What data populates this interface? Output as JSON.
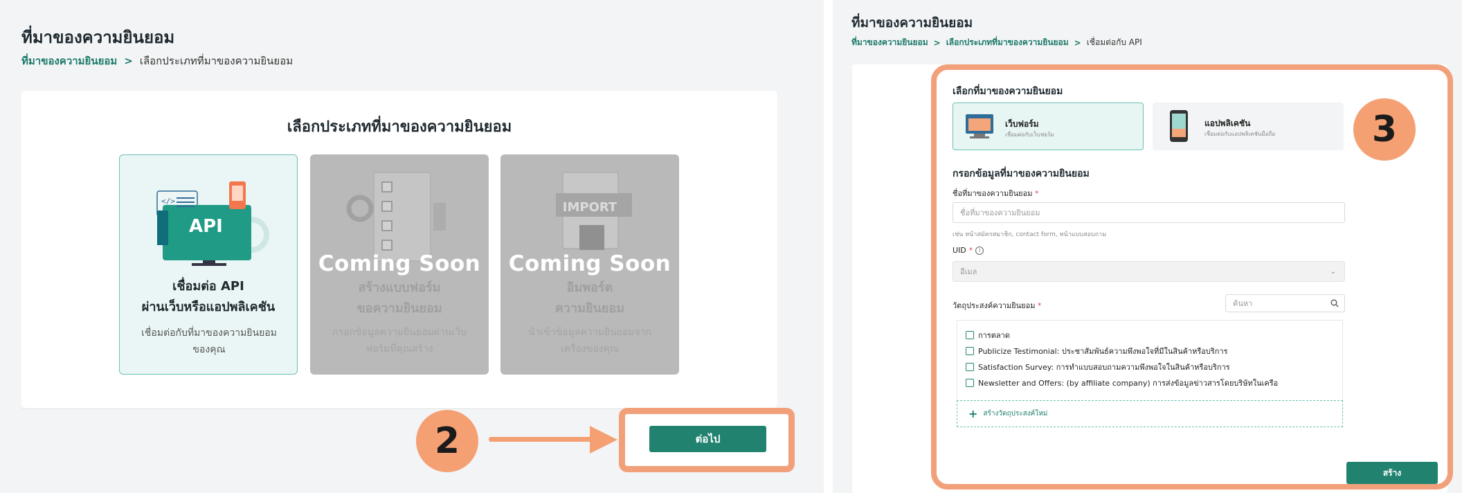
{
  "left": {
    "page_title": "ที่มาของความยินยอม",
    "breadcrumb": {
      "root": "ที่มาของความยินยอม",
      "separator": ">",
      "current": "เลือกประเภทที่มาของความยินยอม"
    },
    "card_title": "เลือกประเภทที่มาของความยินยอม",
    "options": [
      {
        "title_line1": "เชื่อมต่อ API",
        "title_line2": "ผ่านเว็บหรือแอปพลิเคชัน",
        "desc_line1": "เชื่อมต่อกับที่มาของความยินยอม",
        "desc_line2": "ของคุณ",
        "image_text": "API",
        "selected": true
      },
      {
        "badge": "Coming Soon",
        "title_line1": "สร้างแบบฟอร์ม",
        "title_line2": "ขอความยินยอม",
        "desc_line1": "กรอกข้อมูลความยินยอมผ่านเว็บ",
        "desc_line2": "ฟอร์มที่คุณสร้าง",
        "disabled": true
      },
      {
        "badge": "Coming Soon",
        "image_text": "IMPORT",
        "title_line1": "อิมพอร์ต",
        "title_line2": "ความยินยอม",
        "desc_line1": "นำเข้าข้อมูลความยินยอมจาก",
        "desc_line2": "เครื่องของคุณ",
        "disabled": true
      }
    ],
    "next_label": "ต่อไป",
    "step_number": "2"
  },
  "right": {
    "page_title": "ที่มาของความยินยอม",
    "breadcrumb": {
      "root": "ที่มาของความยินยอม",
      "middle": "เลือกประเภทที่มาของความยินยอม",
      "separator": ">",
      "current": "เชื่อมต่อกับ API"
    },
    "section_source": "เลือกที่มาของความยินยอม",
    "types": [
      {
        "title": "เว็บฟอร์ม",
        "subtitle": "เชื่อมต่อกับเว็บฟอร์ม",
        "selected": true
      },
      {
        "title": "แอปพลิเคชัน",
        "subtitle": "เชื่อมต่อกับแอปพลิเคชันมือถือ",
        "selected": false
      }
    ],
    "section_info": "กรอกข้อมูลที่มาของความยินยอม",
    "name_label": "ชื่อที่มาของความยินยอม",
    "required_mark": "*",
    "name_placeholder": "ชื่อที่มาของความยินยอม",
    "name_hint": "เช่น หน้าสมัครสมาชิก, contact form, หน้าแบบสอบถาม",
    "uid_label": "UID",
    "uid_value": "อีเมล",
    "purpose_label": "วัตถุประสงค์ความยินยอม",
    "purpose_search_placeholder": "ค้นหา",
    "purposes": [
      "การตลาด",
      "Publicize Testimonial: ประชาสัมพันธ์ความพึงพอใจที่มีในสินค้าหรือบริการ",
      "Satisfaction Survey: การทำแบบสอบถามความพึงพอใจในสินค้าหรือบริการ",
      "Newsletter and Offers: (by affiliate company) การส่งข้อมูลข่าวสารโดยบริษัทในเครือ"
    ],
    "add_purpose_label": "สร้างวัตถุประสงค์ใหม่",
    "create_label": "สร้าง",
    "step_number": "3"
  },
  "colors": {
    "primary": "#20826f",
    "accent_orange": "#f4a073",
    "selected_bg": "#eaf6f5",
    "disabled_card": "#b9b9b9"
  }
}
